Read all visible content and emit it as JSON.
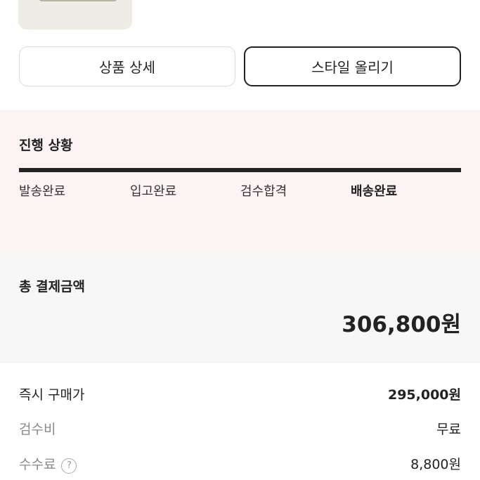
{
  "buttons": {
    "detail": "상품 상세",
    "style": "스타일 올리기"
  },
  "progress": {
    "title": "진행 상황",
    "steps": [
      "발송완료",
      "입고완료",
      "검수합격",
      "배송완료"
    ],
    "current_step": "배송완료"
  },
  "payment": {
    "total_label": "총 결제금액",
    "total_amount": "306,800원",
    "rows": [
      {
        "label": "즉시 구매가",
        "value": "295,000원"
      },
      {
        "label": "검수비",
        "value": "무료"
      },
      {
        "label": "수수료",
        "value": "8,800원",
        "help_icon": "question-circle-icon",
        "help_glyph": "?"
      }
    ]
  }
}
